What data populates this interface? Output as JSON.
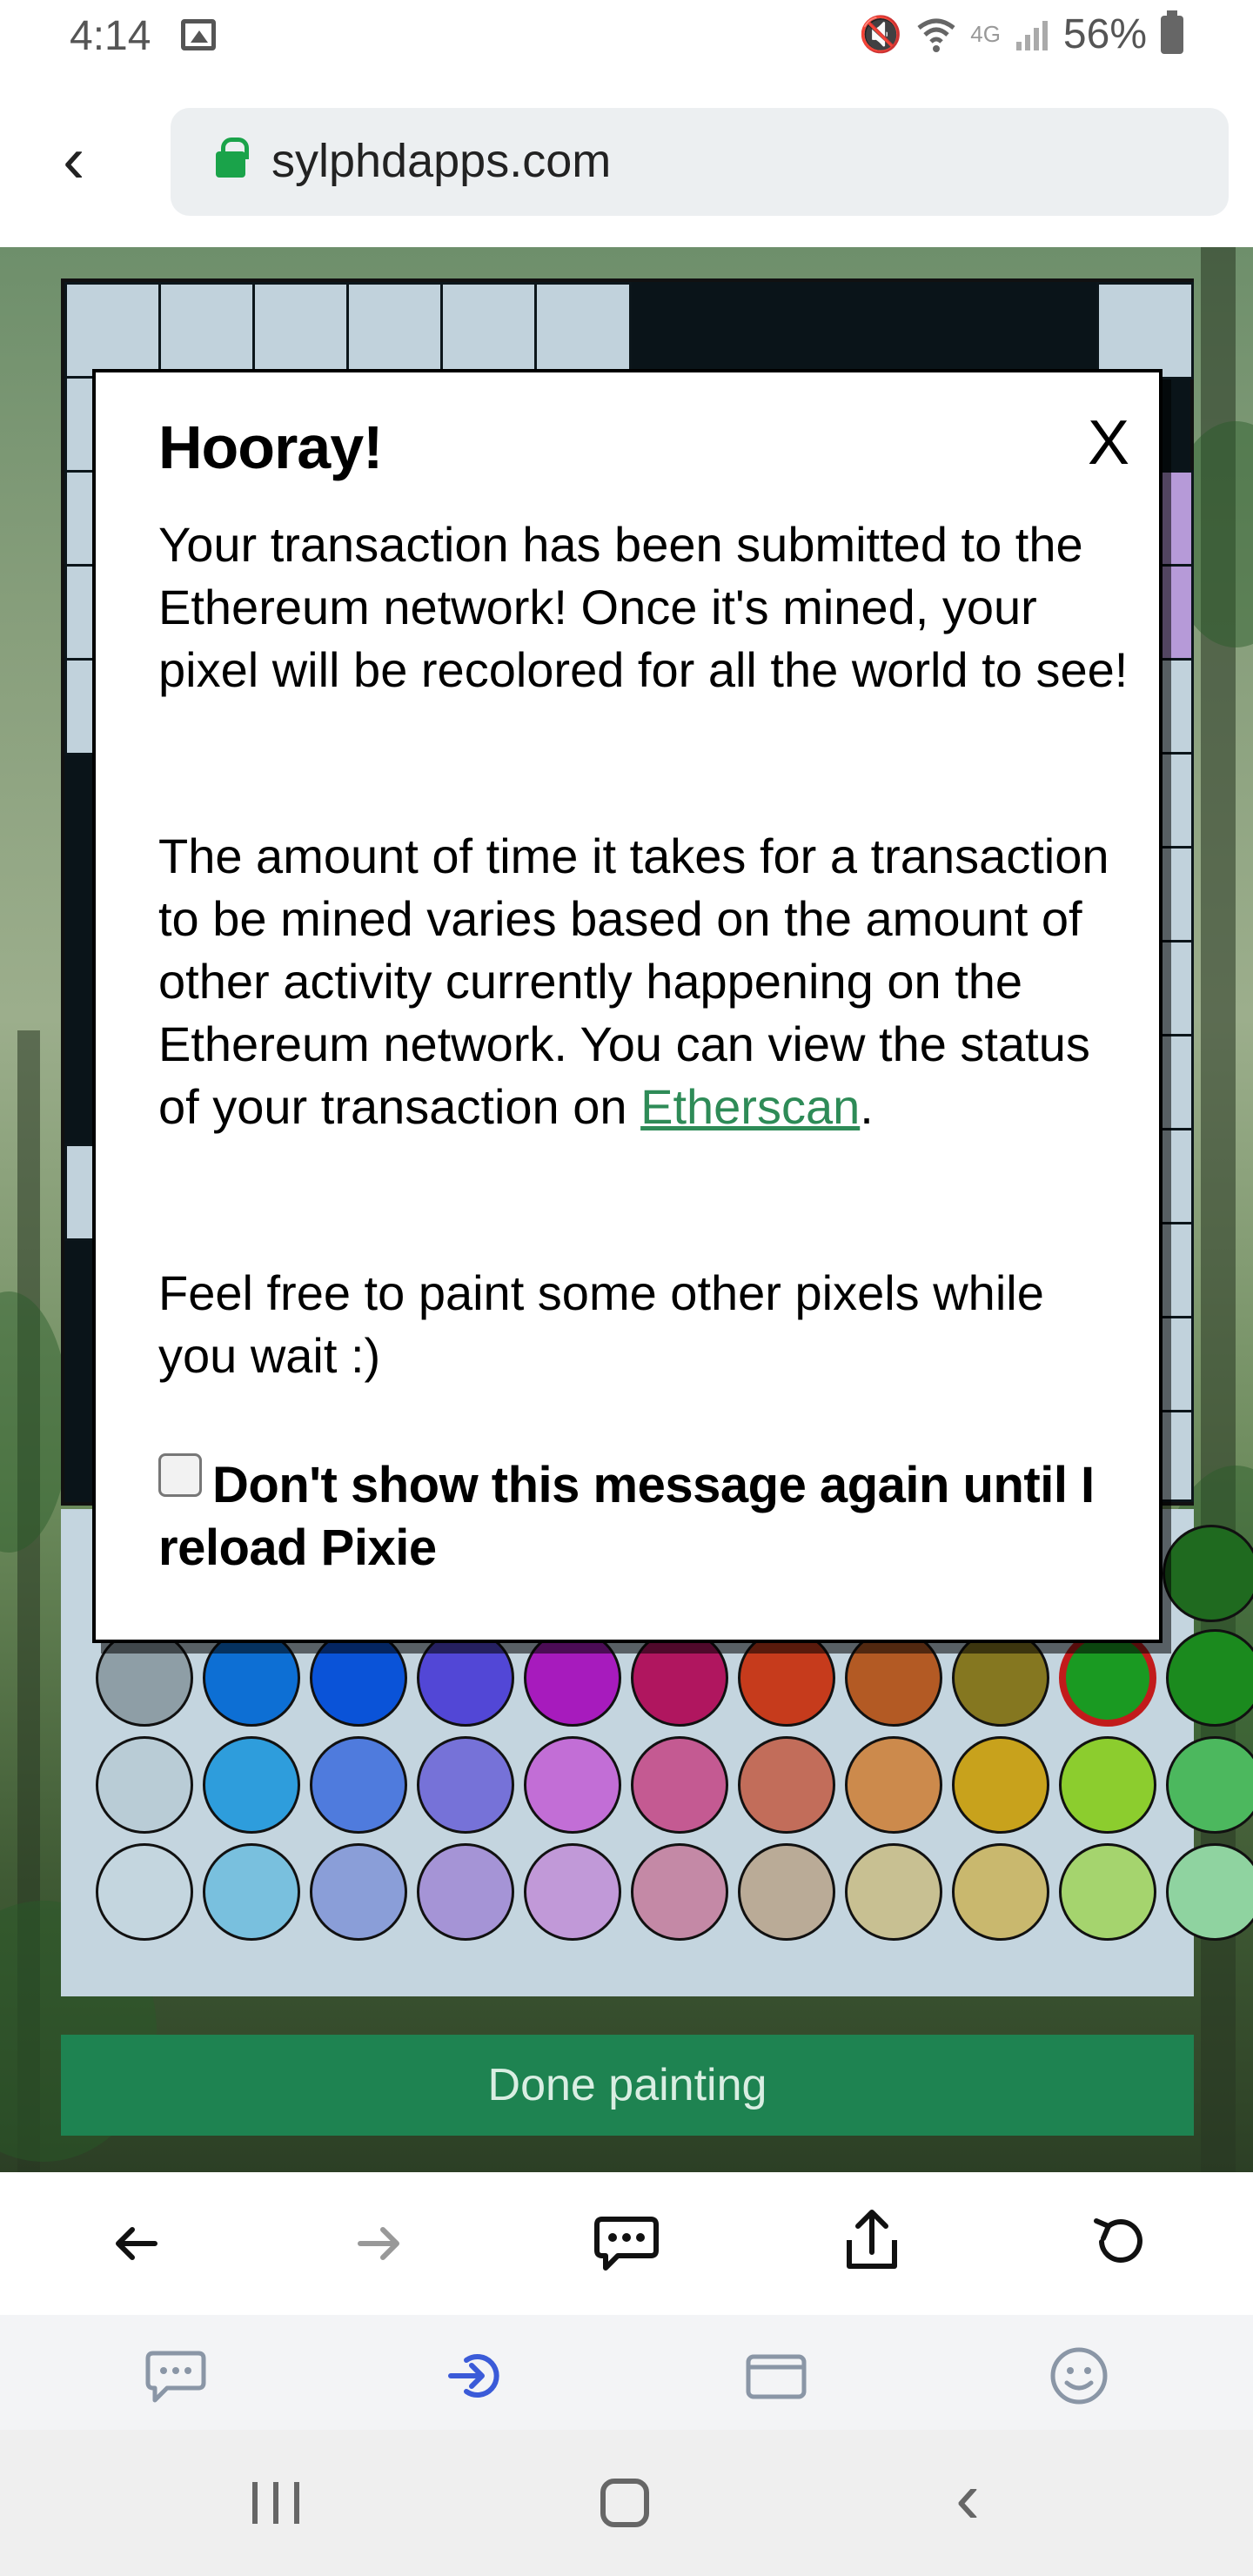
{
  "status_bar": {
    "time": "4:14",
    "network": "4G",
    "battery": "56%"
  },
  "browser": {
    "url": "sylphdapps.com"
  },
  "modal": {
    "title": "Hooray!",
    "close_label": "X",
    "paragraph1": "Your transaction has been submitted to the Ethereum network! Once it's mined, your pixel will be recolored for all the world to see!",
    "paragraph2_before_link": "The amount of time it takes for a transaction to be mined varies based on the amount of other activity currently happening on the Ethereum network. You can view the status of your transaction on ",
    "paragraph2_link": "Etherscan",
    "paragraph2_after_link": ".",
    "paragraph3": "Feel free to paint some other pixels while you wait :)",
    "checkbox_label": "Don't show this message again until I reload Pixie",
    "checkbox_checked": false
  },
  "palette": {
    "selected": "#1a9a22",
    "rows": [
      [
        "#8e9ea6",
        "#0d6fd4",
        "#0a53d8",
        "#5247d6",
        "#a71bbd",
        "#b0165f",
        "#c63b1c",
        "#b35a24",
        "#857720",
        "#1a9a22",
        "#1b8a1e"
      ],
      [
        "#b9ccd6",
        "#2e9ddc",
        "#4f7bdd",
        "#7672d8",
        "#c26ed6",
        "#c45a92",
        "#c26d5a",
        "#cc8a4c",
        "#c8a21c",
        "#8ccd2e",
        "#4cb85e"
      ],
      [
        "#c4d6df",
        "#79c0de",
        "#8a9ed8",
        "#a594d6",
        "#c199d8",
        "#c489a6",
        "#baab97",
        "#c8c092",
        "#c9b86e",
        "#a5d46e",
        "#8fd3a0"
      ]
    ]
  },
  "done_button": {
    "label": "Done painting"
  },
  "toolbar": {
    "back_icon": "arrow-left-icon",
    "forward_icon": "arrow-right-icon",
    "chat_icon": "chat-bubble-icon",
    "share_icon": "share-icon",
    "reload_icon": "reload-icon"
  },
  "app_tabs": [
    {
      "icon": "chat-icon",
      "active": false
    },
    {
      "icon": "dapp-icon",
      "active": true
    },
    {
      "icon": "wallet-icon",
      "active": false
    },
    {
      "icon": "profile-icon",
      "active": false
    }
  ]
}
